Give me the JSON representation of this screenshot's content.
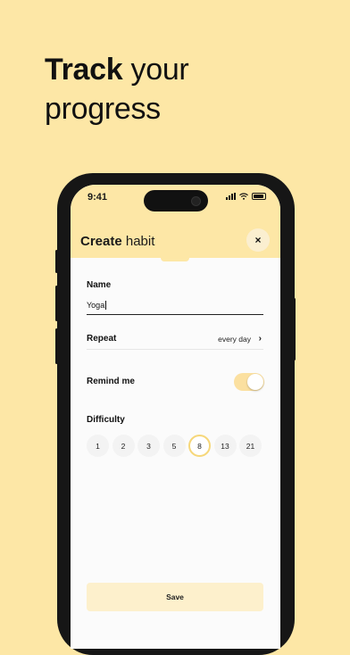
{
  "headline": {
    "bold": "Track",
    "rest_line1": " your",
    "line2": "progress"
  },
  "status_bar": {
    "time": "9:41"
  },
  "header": {
    "title_bold": "Create",
    "title_rest": " habit",
    "close_label": "×"
  },
  "form": {
    "name_label": "Name",
    "name_value": "Yoga",
    "repeat_label": "Repeat",
    "repeat_value": "every day",
    "repeat_chevron": "›",
    "remind_label": "Remind me",
    "remind_on": true,
    "difficulty_label": "Difficulty",
    "difficulty_options": [
      "1",
      "2",
      "3",
      "5",
      "8",
      "13",
      "21"
    ],
    "difficulty_selected": "8",
    "save_label": "Save"
  },
  "colors": {
    "accent": "#fde7a6",
    "toggle_on": "#fbe0a0",
    "selected_ring": "#f6d77a"
  }
}
